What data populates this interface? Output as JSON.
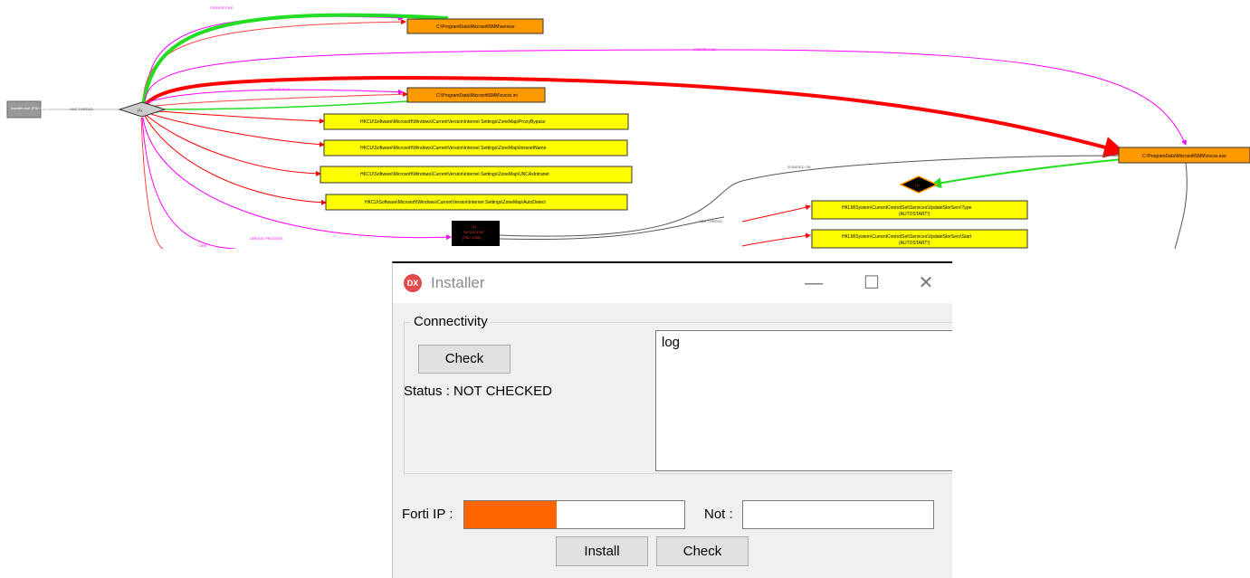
{
  "graph": {
    "nodes": {
      "process_main": "Installer.exe (PID: 6740)",
      "thread": "(1)",
      "file_service": "C:\\ProgramData\\MicrosoftSMM\\servise",
      "file_ini": "C:\\ProgramData\\MicrosoftSMM\\svcss.ini",
      "file_exe": "C:\\ProgramData\\MicrosoftSMM\\svcss.exe",
      "reg_proxy_bypass": "HKCU\\Software\\Microsoft\\Windows\\CurrentVersion\\Internet Settings\\ZoneMap\\ProxyBypass",
      "reg_intranet_name": "HKCU\\Software\\Microsoft\\Windows\\CurrentVersion\\Internet Settings\\ZoneMap\\IntranetName",
      "reg_unc_intranet": "HKCU\\Software\\Microsoft\\Windows\\CurrentVersion\\Internet Settings\\ZoneMap\\UNCAsIntranet",
      "reg_auto_detect": "HKCU\\Software\\Microsoft\\Windows\\CurrentVersion\\Internet Settings\\ZoneMap\\AutoDetect",
      "svcss_line1": "(1)",
      "svcss_line2": "SVCSS.EXE",
      "svcss_line3": "(PID: 1040)",
      "thread2": "(1)",
      "reg_update_type_line1": "HKLM\\System\\CurrentControlSet\\Services\\UpdateStorServ\\Type",
      "reg_update_type_line2": "(AUTOSTART!)",
      "reg_update_start_line1": "HKLM\\System\\CurrentControlSet\\Services\\UpdateStorServ\\Start",
      "reg_update_start_line2": "(AUTOSTART!)"
    },
    "edge_labels": {
      "create_file_top": "CREATE FILE",
      "create_file_long": "CREATE FILE",
      "create_file_ini": "CREATE FILE",
      "has_thread": "HAS THREAD",
      "create_process": "CREATE PROCESS",
      "is_based_on": "IS BASED ON",
      "has_thread_2": "HAS THREAD",
      "create_partial": "CRE"
    },
    "colors": {
      "file_node": "#ff9900",
      "registry_node": "#ffff00",
      "edge_red": "#ff0000",
      "edge_green": "#22dd22",
      "edge_magenta": "#ff00ff"
    }
  },
  "installer": {
    "title": "Installer",
    "icon_text": "DX",
    "icon": "dx-app-icon",
    "minimize_glyph": "—",
    "maximize_glyph": "☐",
    "close_glyph": "✕",
    "group_title": "Connectivity",
    "check_button": "Check",
    "status_text": "Status :  NOT CHECKED",
    "log_text": "log",
    "forti_ip_label": "Forti IP :",
    "forti_ip_value": "",
    "not_label": "Not :",
    "not_value": "",
    "install_button": "Install",
    "check_button_bottom": "Check",
    "redaction_color": "#ff6600"
  }
}
